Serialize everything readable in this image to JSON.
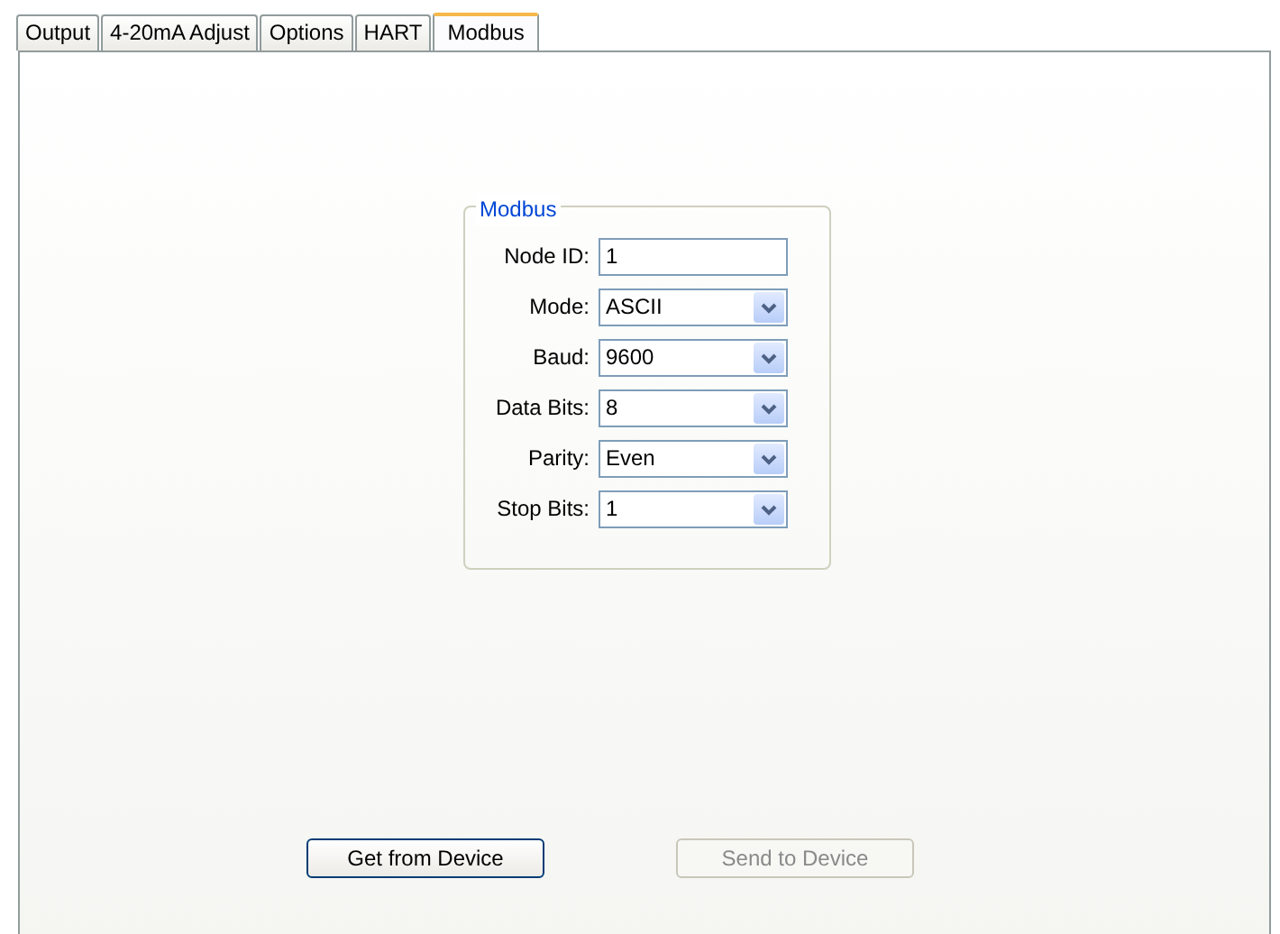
{
  "tabs": [
    {
      "label": "Output",
      "selected": false
    },
    {
      "label": "4-20mA Adjust",
      "selected": false
    },
    {
      "label": "Options",
      "selected": false
    },
    {
      "label": "HART",
      "selected": false
    },
    {
      "label": "Modbus",
      "selected": true
    }
  ],
  "group": {
    "title": "Modbus",
    "fields": [
      {
        "label": "Node ID:",
        "kind": "text",
        "value": "1"
      },
      {
        "label": "Mode:",
        "kind": "select",
        "value": "ASCII"
      },
      {
        "label": "Baud:",
        "kind": "select",
        "value": "9600"
      },
      {
        "label": "Data Bits:",
        "kind": "select",
        "value": "8"
      },
      {
        "label": "Parity:",
        "kind": "select",
        "value": "Even"
      },
      {
        "label": "Stop Bits:",
        "kind": "select",
        "value": "1"
      }
    ]
  },
  "buttons": [
    {
      "label": "Get from Device",
      "disabled": false
    },
    {
      "label": "Send to Device",
      "disabled": true
    }
  ]
}
